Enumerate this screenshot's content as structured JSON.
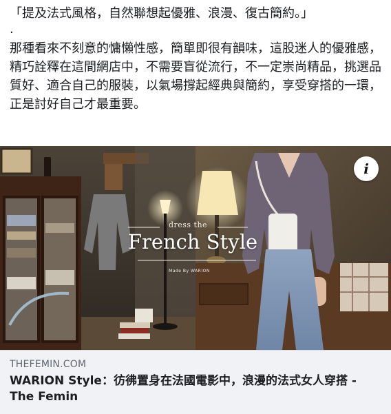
{
  "post": {
    "quote": "「提及法式風格，自然聯想起優雅、浪漫、復古簡約。」",
    "dot": ".",
    "paragraph": "那種看來不刻意的慵懶性感，簡單即很有韻味，這股迷人的優雅感，精巧詮釋在這間網店中，不需要盲從流行，不一定崇尚精品，挑選品質好、適合自己的服裝，以氣場撐起經典與簡約，享受穿搭的一環，正是討好自己才最重要。"
  },
  "hero_image": {
    "subtitle": "dress the",
    "title": "French Style",
    "maker": "Made By WARION",
    "info_label": "i"
  },
  "link": {
    "domain": "THEFEMIN.COM",
    "title": "WARION Style：彷彿置身在法國電影中，浪漫的法式女人穿搭 - The Femin"
  }
}
